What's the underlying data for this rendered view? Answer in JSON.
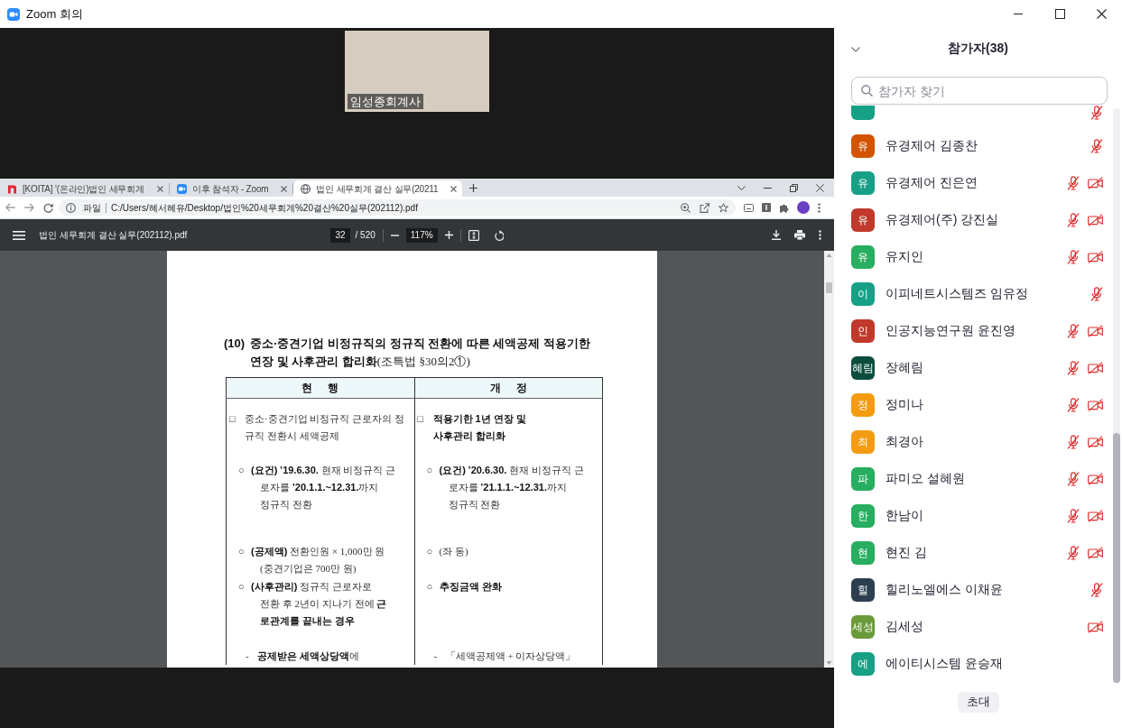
{
  "window": {
    "title": "Zoom 회의"
  },
  "video_tile": {
    "name": "임성종회계사"
  },
  "shared_screen": {
    "browser": {
      "tabs": [
        {
          "title": "[KOITA] '(온라인)법인 세무회계",
          "selected": false
        },
        {
          "title": "이후 참석자 - Zoom",
          "selected": false
        },
        {
          "title": "법인 세무회계 결산 실무(20211",
          "selected": true
        }
      ],
      "address": {
        "scheme": "파일",
        "url": "C:/Users/혜서혜유/Desktop/법인%20세무회계%20결산%20실무(202112).pdf"
      }
    },
    "pdf_viewer": {
      "file_name": "법인 세무회계 결산 실무(202112).pdf",
      "page": "32",
      "page_count": "/ 520",
      "zoom": "117%"
    },
    "document": {
      "heading": {
        "number": "(10)",
        "lines": [
          "**중소·중견기업 비정규직의 정규직 전환에 따른 세액공제 적용기한**",
          "**연장 및 사후관리 합리화**(조특법 §30의2①)"
        ]
      },
      "table": {
        "columns": [
          "현 행",
          "개 정"
        ],
        "rows": [
          {
            "cells": [
              {
                "kind": "box",
                "marker": "□",
                "bold": false,
                "lines": [
                  "중소·중견기업 비정규직 근로자의 정",
                  "규직 전환시 세액공제"
                ]
              },
              {
                "kind": "box",
                "marker": "□",
                "bold": true,
                "lines": [
                  "적용기한 1년 연장 및",
                  "사후관리 합리화"
                ]
              }
            ]
          },
          {
            "cells": [
              {
                "kind": "circle",
                "marker": "○",
                "bold": false,
                "lines": [
                  "**(요건)** **’19.6.30.** 현재 비정규직 근",
                  "로자를 **’20.1.1.~12.31.**까지",
                  "정규직 전환"
                ]
              },
              {
                "kind": "circle",
                "marker": "○",
                "bold": false,
                "lines": [
                  "**(요건)** **’20.6.30.** 현재 비정규직 근",
                  "로자를 **’21.1.1.~12.31.**까지",
                  "정규직 전환"
                ]
              }
            ]
          },
          {
            "cells": [
              {
                "kind": "circle",
                "marker": "○",
                "bold": false,
                "lines": [
                  "**(공제액)** 전환인원 × 1,000만 원",
                  "(중견기업은 700만 원)"
                ]
              },
              {
                "kind": "circle",
                "marker": "○",
                "bold": false,
                "lines": [
                  "(좌 동)"
                ]
              }
            ]
          },
          {
            "cells": [
              {
                "kind": "circle",
                "marker": "○",
                "bold": false,
                "lines": [
                  "**(사후관리)** 정규직 근로자로",
                  "전환 후 2년이 지나기 전에 **근**",
                  "**로관계를 끝내는 경우**"
                ]
              },
              {
                "kind": "circle",
                "marker": "○",
                "bold": true,
                "lines": [
                  "추징금액 완화"
                ]
              }
            ]
          },
          {
            "cells": [
              {
                "kind": "dash",
                "marker": "-",
                "bold": false,
                "lines": [
                  "**공제받은 세액상당액**에"
                ]
              },
              {
                "kind": "dash",
                "marker": "-",
                "bold": false,
                "lines": [
                  "「세액공제액 + 이자상당액」"
                ]
              }
            ]
          }
        ]
      }
    }
  },
  "participants_panel": {
    "title": "참가자(38)",
    "search": {
      "placeholder": "참가자 찾기"
    },
    "partial_row": {
      "color": "#16a085",
      "audio_muted": true
    },
    "participants": [
      {
        "initial": "유",
        "name": "유경제어 김종찬",
        "color": "#d35400",
        "audio_muted": true,
        "video_off": false
      },
      {
        "initial": "유",
        "name": "유경제어 진은연",
        "color": "#16a085",
        "audio_muted": true,
        "video_off": true
      },
      {
        "initial": "유",
        "name": "유경제어(주) 강진실",
        "color": "#c0392b",
        "audio_muted": true,
        "video_off": true
      },
      {
        "initial": "유",
        "name": "유지인",
        "color": "#27ae60",
        "audio_muted": true,
        "video_off": true
      },
      {
        "initial": "이",
        "name": "이피네트시스템즈 임유정",
        "color": "#16a085",
        "audio_muted": true,
        "video_off": false
      },
      {
        "initial": "인",
        "name": "인공지능연구원 윤진영",
        "color": "#c0392b",
        "audio_muted": true,
        "video_off": true
      },
      {
        "initial": "혜림",
        "name": "장혜림",
        "color": "#0b4d3d",
        "audio_muted": true,
        "video_off": true
      },
      {
        "initial": "정",
        "name": "정미나",
        "color": "#f39c12",
        "audio_muted": true,
        "video_off": true
      },
      {
        "initial": "최",
        "name": "최경아",
        "color": "#f39c12",
        "audio_muted": true,
        "video_off": true
      },
      {
        "initial": "파",
        "name": "파미오 설혜원",
        "color": "#27ae60",
        "audio_muted": true,
        "video_off": true
      },
      {
        "initial": "한",
        "name": "한남이",
        "color": "#27ae60",
        "audio_muted": true,
        "video_off": true
      },
      {
        "initial": "현",
        "name": "현진 김",
        "color": "#27ae60",
        "audio_muted": true,
        "video_off": true
      },
      {
        "initial": "힐",
        "name": "힐리노엘에스 이채윤",
        "color": "#2c3e50",
        "audio_muted": true,
        "video_off": false
      },
      {
        "initial": "세성",
        "name": "김세성",
        "color": "#6a9a3a",
        "audio_muted": false,
        "video_off": true
      },
      {
        "initial": "에",
        "name": "에이티시스템 윤승재",
        "color": "#16a085",
        "audio_muted": false,
        "video_off": false
      }
    ],
    "invite_button": "초대"
  }
}
